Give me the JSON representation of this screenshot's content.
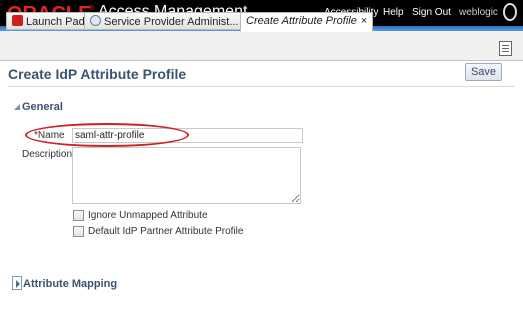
{
  "header": {
    "brand": "ORACLE",
    "registered_mark": "®",
    "product": "Access Management",
    "links": [
      "Accessibility",
      "Help",
      "Sign Out"
    ],
    "user": "weblogic",
    "user_icon": "user-icon"
  },
  "tabs": [
    {
      "label": "Launch Pad",
      "icon": "launch-pad-icon"
    },
    {
      "label": "Service Provider Administ...",
      "icon": "service-provider-icon",
      "close": "×"
    },
    {
      "label": "Create Attribute Profile",
      "close": "×"
    }
  ],
  "page": {
    "title": "Create IdP Attribute Profile",
    "save_label": "Save"
  },
  "general": {
    "heading": "General",
    "name_required": "*",
    "name_label": "Name",
    "name_value": "saml-attr-profile",
    "description_label": "Description",
    "description_value": "",
    "checkboxes": [
      {
        "label": "Ignore Unmapped Attribute",
        "checked": false
      },
      {
        "label": "Default IdP Partner Attribute Profile",
        "checked": false
      }
    ]
  },
  "attribute_mapping": {
    "heading": "Attribute Mapping"
  },
  "colors": {
    "brand_red": "#e3251d",
    "header_bg": "#000000",
    "title_blue": "#3a5470",
    "highlight_red": "#cc2222"
  }
}
